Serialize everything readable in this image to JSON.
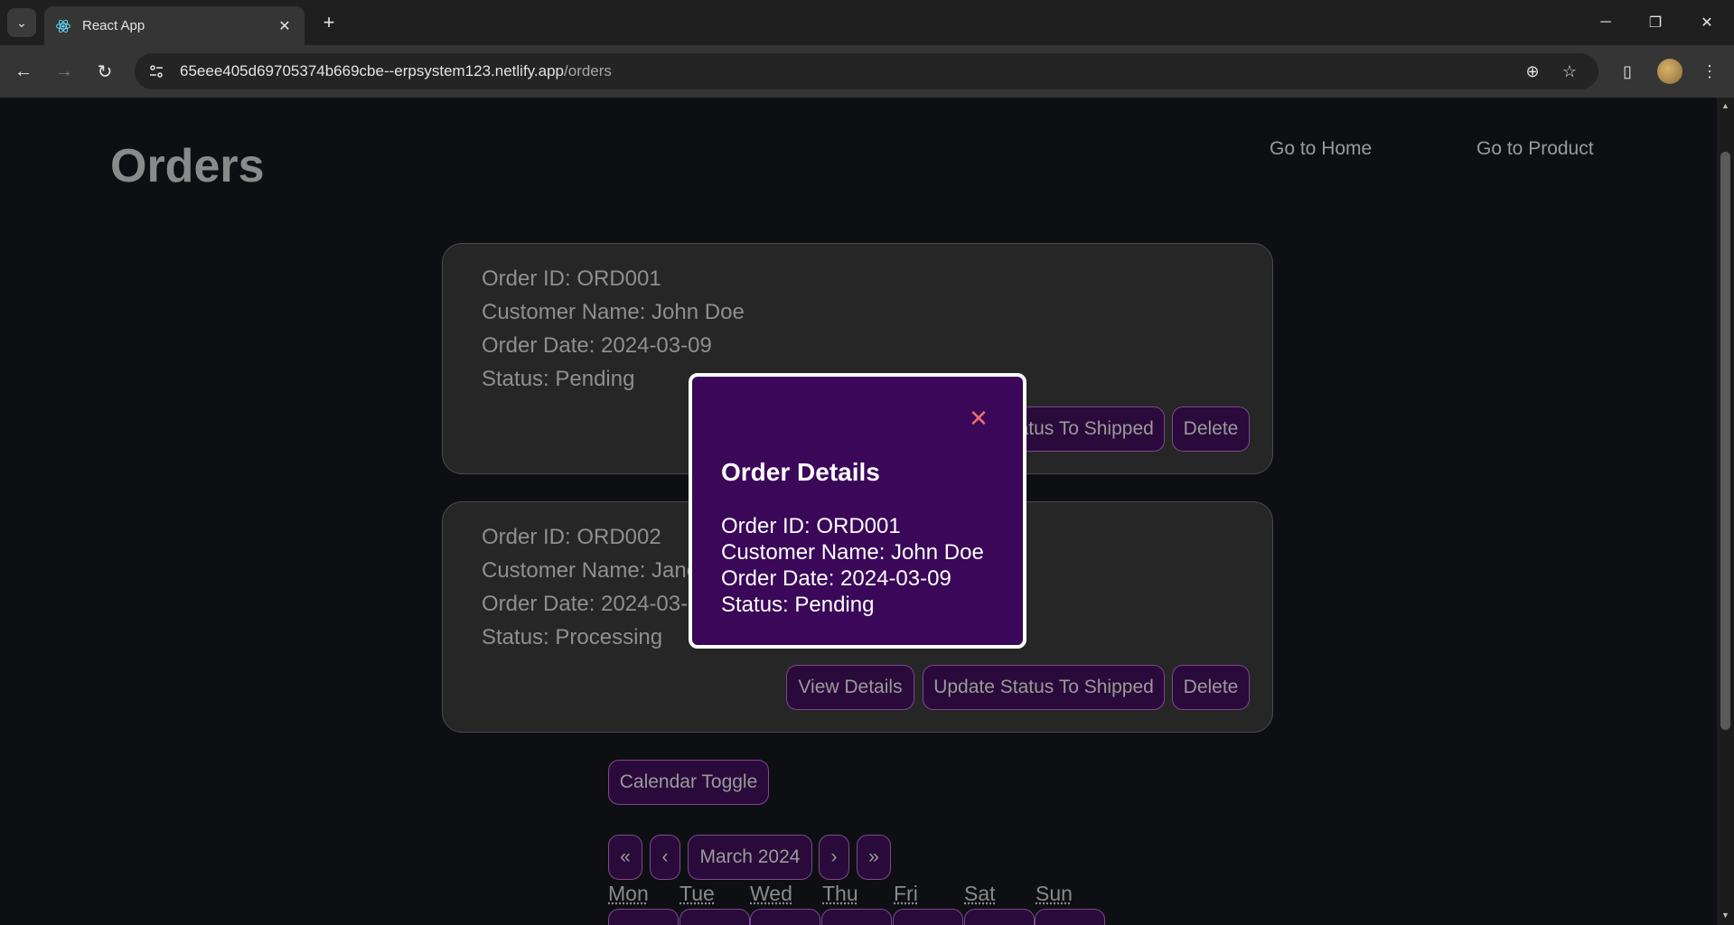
{
  "browser": {
    "tab_title": "React App",
    "url_host": "65eee405d69705374b669cbe--erpsystem123.netlify.app",
    "url_path": "/orders"
  },
  "header": {
    "title": "Orders",
    "nav_home": "Go to Home",
    "nav_product": "Go to Product"
  },
  "orders": [
    {
      "order_id": "Order ID: ORD001",
      "customer": "Customer Name: John Doe",
      "date": "Order Date: 2024-03-09",
      "status": "Status: Pending",
      "update_label": "Update Status To Shipped",
      "delete_label": "Delete"
    },
    {
      "order_id": "Order ID: ORD002",
      "customer": "Customer Name: Jane Smith",
      "date": "Order Date: 2024-03-09",
      "status": "Status: Processing",
      "view_label": "View Details",
      "update_label": "Update Status To Shipped",
      "delete_label": "Delete"
    }
  ],
  "calendar": {
    "toggle_label": "Calendar Toggle",
    "prev_year": "«",
    "prev_month": "‹",
    "month_label": "March 2024",
    "next_month": "›",
    "next_year": "»",
    "weekdays": [
      "Mon",
      "Tue",
      "Wed",
      "Thu",
      "Fri",
      "Sat",
      "Sun"
    ]
  },
  "modal": {
    "close_glyph": "✕",
    "title": "Order Details",
    "order_id": "Order ID: ORD001",
    "customer": "Customer Name: John Doe",
    "date": "Order Date: 2024-03-09",
    "status": "Status: Pending"
  }
}
